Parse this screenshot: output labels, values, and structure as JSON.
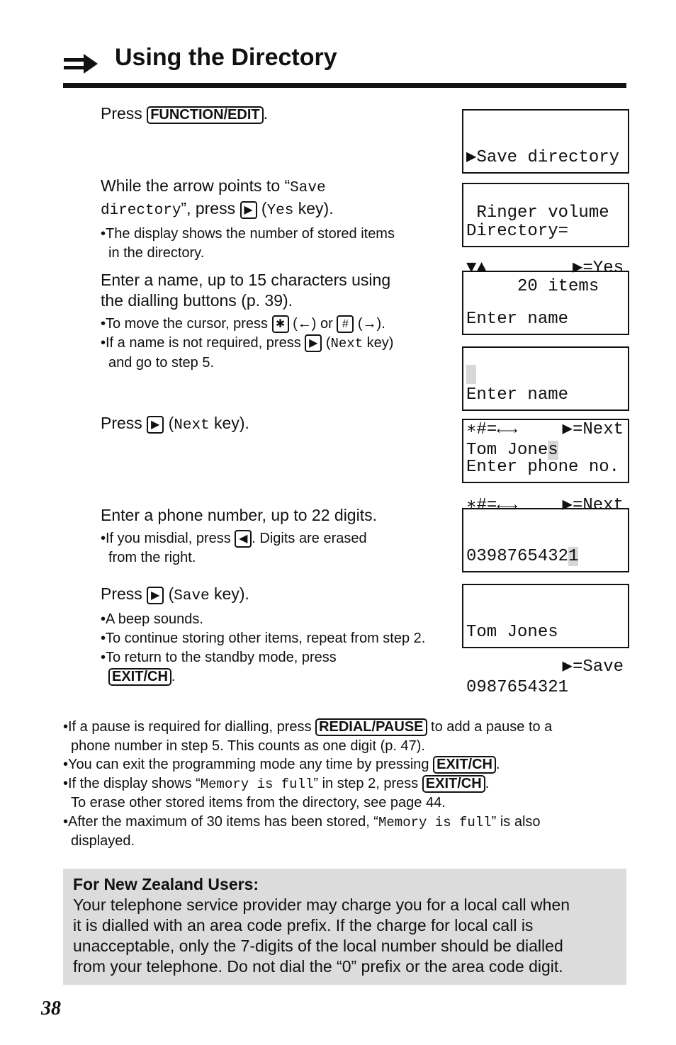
{
  "header": {
    "title": "Using the Directory",
    "icon": "right-arrow-icon"
  },
  "keys": {
    "function_edit": "FUNCTION/EDIT",
    "exit_ch": "EXIT/CH",
    "redial_pause": "REDIAL/PAUSE",
    "right": "▶",
    "left": "◀",
    "star": "✱",
    "hash": "#"
  },
  "steps": [
    {
      "a": "Press ",
      "b": "."
    },
    {
      "a": "While the arrow points to “",
      "mono1": "Save",
      "mono2": "directory",
      "b": "”, press ",
      "c": " (",
      "mono3": "Yes",
      "d": " key).",
      "bullet1a": "•The display shows the number of stored items",
      "bullet1b": "in the directory."
    },
    {
      "l1": "Enter a name, up to 15 characters using",
      "l2": "the dialling buttons (p. 39).",
      "b1a": "•To move the cursor, press ",
      "b1b": " (←) or ",
      "b1c": " (→).",
      "b2a": "•If a name is not required, press ",
      "b2b": " (",
      "b2mono": "Next",
      "b2c": " key)",
      "b2d": "and go to step 5."
    },
    {
      "a": "Press ",
      "b": " (",
      "mono": "Next",
      "c": " key)."
    },
    {
      "l1": "Enter a phone number, up to 22 digits.",
      "b1a": "•If you misdial, press ",
      "b1b": ". Digits are erased",
      "b1c": "from the right."
    },
    {
      "a": "Press ",
      "b": " (",
      "mono": "Save",
      "c": " key).",
      "b1": "•A beep sounds.",
      "b2": "•To continue storing other items, repeat from step 2.",
      "b3": "•To return to the standby mode, press",
      "b4end": "."
    }
  ],
  "displays": [
    {
      "l1": "▶Save directory",
      "l2": " Ringer volume",
      "l3a": "▼▲",
      "l3b": "▶=Yes"
    },
    {
      "l1": "Directory=",
      "l2": "     20 items"
    },
    {
      "l1": "Enter name",
      "l3a": "∗#=←→",
      "l3b": "▶=Next"
    },
    {
      "l1": "Enter name",
      "l2": "Tom Jone",
      "l2cur": "s",
      "l3a": "∗#=←→",
      "l3b": "▶=Next"
    },
    {
      "l1": "Enter phone no."
    },
    {
      "l1": "0398765432",
      "l1cur": "1",
      "l3b": "▶=Save"
    },
    {
      "l1": "Tom Jones",
      "l2": "0987654321"
    }
  ],
  "notes": {
    "n1a": "•If a pause is required for dialling, press ",
    "n1b": " to add a pause to a",
    "n1c": "phone number in step 5. This counts as one digit (p. 47).",
    "n2a": "•You can exit the programming mode any time by pressing ",
    "n2b": ".",
    "n3a": "•If the display shows  “",
    "n3mono": "Memory is full",
    "n3b": "” in step 2, press ",
    "n3c": ".",
    "n3d": "To erase other stored items from the directory, see page 44.",
    "n4a": "•After the maximum of 30 items has been stored, “",
    "n4mono": "Memory is full",
    "n4b": "” is also",
    "n4c": "displayed."
  },
  "nz": {
    "heading": "For New Zealand Users:",
    "l1": "Your telephone service provider may charge you for a local call when",
    "l2": "it is dialled with an area code prefix. If the charge for local call is",
    "l3": "unacceptable, only the 7-digits of the local number should be dialled",
    "l4": "from your telephone. Do not dial the “0” prefix or the area code digit."
  },
  "page_number": "38"
}
